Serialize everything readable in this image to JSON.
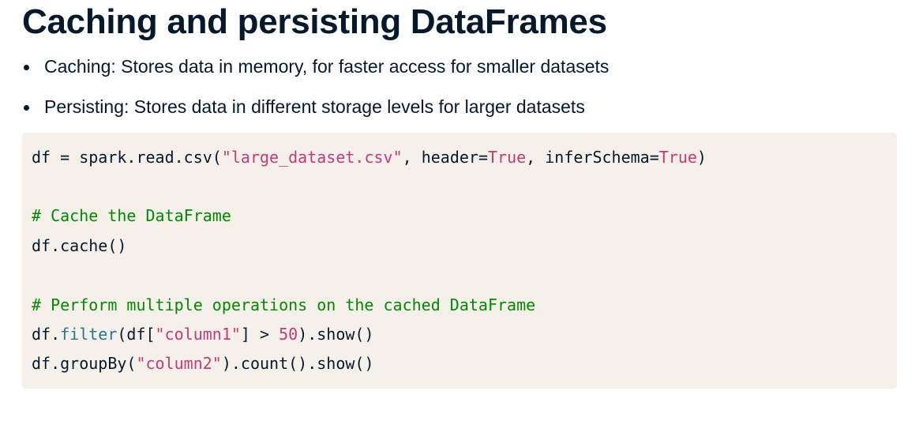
{
  "slide": {
    "title": "Caching and persisting DataFrames",
    "bullets": [
      "Caching: Stores data in memory, for faster access for smaller datasets",
      "Persisting: Stores data in different storage levels for larger datasets"
    ]
  },
  "code": {
    "line1": {
      "a": "df = spark.read.csv(",
      "b": "\"large_dataset.csv\"",
      "c": ", header=",
      "d": "True",
      "e": ", inferSchema=",
      "f": "True",
      "g": ")"
    },
    "comment1": "# Cache the DataFrame",
    "line2": "df.cache()",
    "comment2": "# Perform multiple operations on the cached DataFrame",
    "line3": {
      "a": "df.",
      "b": "filter",
      "c": "(df[",
      "d": "\"column1\"",
      "e": "] > ",
      "f": "50",
      "g": ").show()"
    },
    "line4": {
      "a": "df.groupBy(",
      "b": "\"column2\"",
      "c": ").count().show()"
    }
  },
  "colors": {
    "text": "#05192d",
    "code_background": "#f5f1ea",
    "string": "#c73a76",
    "comment": "#008a00",
    "builtin": "#1f7a8c"
  }
}
